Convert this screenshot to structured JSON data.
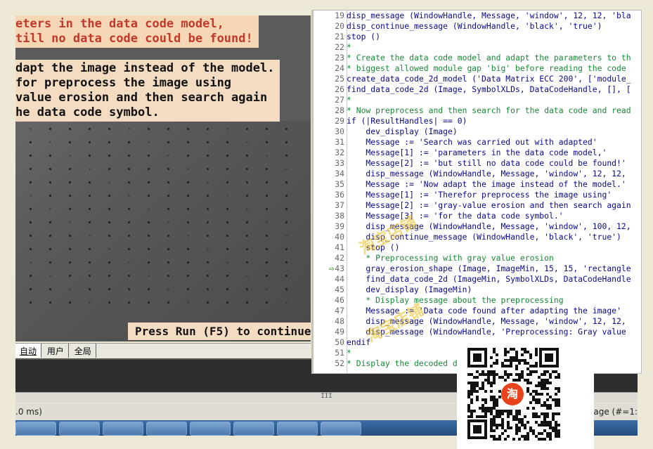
{
  "graphics": {
    "msg1": "eters in the data code model,\ntill no data code could be found!",
    "msg2": "dapt the image instead of the model.\nfor preprocess the image using\nvalue erosion and then search again\nhe data code symbol.",
    "press_run": "Press Run (F5) to continue"
  },
  "tabs": [
    {
      "label": "自动"
    },
    {
      "label": "用户"
    },
    {
      "label": "全局"
    }
  ],
  "status": {
    "left": ".0 ms)",
    "right": "age (#=1:"
  },
  "hscroll_grip": "III",
  "editor": {
    "lines": [
      {
        "n": "19",
        "text": "disp_message (WindowHandle, Message, 'window', 12, 12, 'bla",
        "kind": "code"
      },
      {
        "n": "20",
        "text": "disp_continue_message (WindowHandle, 'black', 'true')",
        "kind": "code"
      },
      {
        "n": "21",
        "text": "stop ()",
        "kind": "code"
      },
      {
        "n": "22",
        "text": "*",
        "kind": "comment"
      },
      {
        "n": "23",
        "text": "* Create the data code model and adapt the parameters to th",
        "kind": "comment"
      },
      {
        "n": "24",
        "text": "* biggest allowed module gap 'big' before reading the code",
        "kind": "comment"
      },
      {
        "n": "25",
        "text": "create_data_code_2d_model ('Data Matrix ECC 200', ['module_",
        "kind": "code"
      },
      {
        "n": "26",
        "text": "find_data_code_2d (Image, SymbolXLDs, DataCodeHandle, [], [",
        "kind": "code"
      },
      {
        "n": "27",
        "text": "*",
        "kind": "comment"
      },
      {
        "n": "28",
        "text": "* Now preprocess and then search for the data code and read",
        "kind": "comment"
      },
      {
        "n": "29",
        "text": "if (|ResultHandles| == 0)",
        "kind": "code"
      },
      {
        "n": "30",
        "text": "    dev_display (Image)",
        "kind": "code"
      },
      {
        "n": "31",
        "text": "    Message := 'Search was carried out with adapted'",
        "kind": "code"
      },
      {
        "n": "32",
        "text": "    Message[1] := 'parameters in the data code model,'",
        "kind": "code"
      },
      {
        "n": "33",
        "text": "    Message[2] := 'but still no data code could be found!'",
        "kind": "code"
      },
      {
        "n": "34",
        "text": "    disp_message (WindowHandle, Message, 'window', 12, 12,",
        "kind": "code"
      },
      {
        "n": "35",
        "text": "    Message := 'Now adapt the image instead of the model.'",
        "kind": "code"
      },
      {
        "n": "36",
        "text": "    Message[1] := 'Therefor preprocess the image using'",
        "kind": "code"
      },
      {
        "n": "37",
        "text": "    Message[2] := 'gray-value erosion and then search again",
        "kind": "code"
      },
      {
        "n": "38",
        "text": "    Message[3] := 'for the data code symbol.'",
        "kind": "code"
      },
      {
        "n": "39",
        "text": "    disp_message (WindowHandle, Message, 'window', 100, 12,",
        "kind": "code"
      },
      {
        "n": "40",
        "text": "    disp_continue_message (WindowHandle, 'black', 'true')",
        "kind": "code"
      },
      {
        "n": "41",
        "text": "    stop ()",
        "kind": "code"
      },
      {
        "n": "42",
        "text": "    * Preprocessing with gray value erosion",
        "kind": "comment"
      },
      {
        "n": "43",
        "text": "    gray_erosion_shape (Image, ImageMin, 15, 15, 'rectangle",
        "kind": "code"
      },
      {
        "n": "44",
        "text": "    find_data_code_2d (ImageMin, SymbolXLDs, DataCodeHandle",
        "kind": "code"
      },
      {
        "n": "45",
        "text": "    dev_display (ImageMin)",
        "kind": "code"
      },
      {
        "n": "46",
        "text": "    * Display message about the preprocessing",
        "kind": "comment"
      },
      {
        "n": "47",
        "text": "    Message := 'Data code found after adapting the image'",
        "kind": "code"
      },
      {
        "n": "48",
        "text": "    disp_message (WindowHandle, Message, 'window', 12, 12,",
        "kind": "code"
      },
      {
        "n": "49",
        "text": "    disp_message (WindowHandle, 'Preprocessing: Gray value",
        "kind": "code"
      },
      {
        "n": "50",
        "text": "endif",
        "kind": "code"
      },
      {
        "n": "51",
        "text": "*",
        "kind": "comment"
      },
      {
        "n": "52",
        "text": "* Display the decoded d",
        "kind": "comment"
      }
    ],
    "current_line": "43"
  },
  "qr": {
    "logo": "淘"
  }
}
